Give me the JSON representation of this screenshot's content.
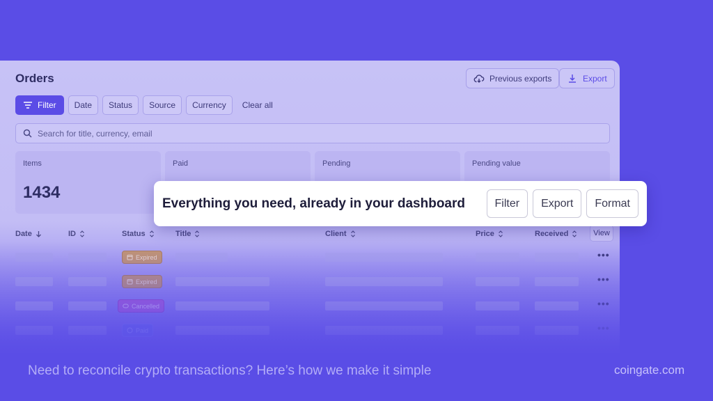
{
  "app": {
    "title": "Orders"
  },
  "toolbar": {
    "previous_exports_label": "Previous exports",
    "export_label": "Export"
  },
  "filters": [
    {
      "label": "Filter",
      "primary": true
    },
    {
      "label": "Date"
    },
    {
      "label": "Status"
    },
    {
      "label": "Source"
    },
    {
      "label": "Currency"
    }
  ],
  "clear_all_label": "Clear all",
  "search": {
    "placeholder": "Search for title, currency, email"
  },
  "stats": [
    {
      "label": "Items",
      "value": "1434"
    },
    {
      "label": "Paid",
      "value": ""
    },
    {
      "label": "Pending",
      "value": ""
    },
    {
      "label": "Pending value",
      "value": ""
    }
  ],
  "table": {
    "columns": [
      "Date",
      "ID",
      "Status",
      "Title",
      "Client",
      "Price",
      "Received"
    ],
    "view_label": "View",
    "rows": [
      {
        "status": "Expired",
        "status_type": "expired"
      },
      {
        "status": "Expired",
        "status_type": "expired"
      },
      {
        "status": "Cancelled",
        "status_type": "cancelled"
      },
      {
        "status": "Paid",
        "status_type": "paid"
      }
    ]
  },
  "callout": {
    "text": "Everything you need, already in your dashboard",
    "buttons": [
      "Filter",
      "Export",
      "Format"
    ]
  },
  "footer": {
    "tagline": "Need to reconcile crypto transactions? Here’s how we make it simple",
    "brand": "coingate.com"
  },
  "colors": {
    "background": "#5a4de6",
    "accent": "#5b4ce6",
    "panel": "#c7c2f6"
  }
}
